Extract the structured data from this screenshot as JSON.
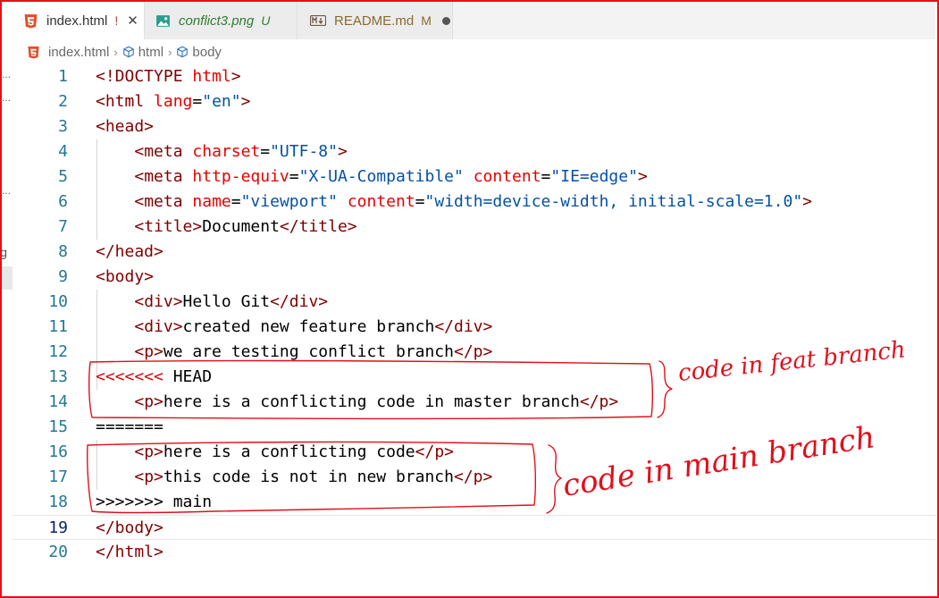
{
  "tabs": [
    {
      "name": "index.html",
      "status": "!",
      "icon": "html5-icon",
      "close": "✕",
      "active": true
    },
    {
      "name": "conflict3.png",
      "status": "U",
      "icon": "image-icon",
      "active": false
    },
    {
      "name": "README.md",
      "status": "M",
      "icon": "markdown-icon",
      "active": false,
      "dirty": true
    }
  ],
  "breadcrumb": {
    "file": "index.html",
    "items": [
      "html",
      "body"
    ]
  },
  "left_strip": {
    "glyph": "g"
  },
  "editor": {
    "lines": [
      {
        "n": "1",
        "tokens": [
          [
            "t",
            "<!DOCTYPE "
          ],
          [
            "a",
            "html"
          ],
          [
            "t",
            ">"
          ]
        ]
      },
      {
        "n": "2",
        "tokens": [
          [
            "t",
            "<html "
          ],
          [
            "a",
            "lang"
          ],
          [
            "p",
            "="
          ],
          [
            "s",
            "\"en\""
          ],
          [
            "t",
            ">"
          ]
        ]
      },
      {
        "n": "3",
        "tokens": [
          [
            "t",
            "<head>"
          ]
        ]
      },
      {
        "n": "4",
        "tokens": [
          [
            "p",
            "    "
          ],
          [
            "t",
            "<meta "
          ],
          [
            "a",
            "charset"
          ],
          [
            "p",
            "="
          ],
          [
            "s",
            "\"UTF-8\""
          ],
          [
            "t",
            ">"
          ]
        ]
      },
      {
        "n": "5",
        "tokens": [
          [
            "p",
            "    "
          ],
          [
            "t",
            "<meta "
          ],
          [
            "a",
            "http-equiv"
          ],
          [
            "p",
            "="
          ],
          [
            "s",
            "\"X-UA-Compatible\""
          ],
          [
            "p",
            " "
          ],
          [
            "a",
            "content"
          ],
          [
            "p",
            "="
          ],
          [
            "s",
            "\"IE=edge\""
          ],
          [
            "t",
            ">"
          ]
        ]
      },
      {
        "n": "6",
        "tokens": [
          [
            "p",
            "    "
          ],
          [
            "t",
            "<meta "
          ],
          [
            "a",
            "name"
          ],
          [
            "p",
            "="
          ],
          [
            "s",
            "\"viewport\""
          ],
          [
            "p",
            " "
          ],
          [
            "a",
            "content"
          ],
          [
            "p",
            "="
          ],
          [
            "s",
            "\"width=device-width, initial-scale=1.0\""
          ],
          [
            "t",
            ">"
          ]
        ]
      },
      {
        "n": "7",
        "tokens": [
          [
            "p",
            "    "
          ],
          [
            "t",
            "<title>"
          ],
          [
            "p",
            "Document"
          ],
          [
            "t",
            "</title>"
          ]
        ]
      },
      {
        "n": "8",
        "tokens": [
          [
            "t",
            "</head>"
          ]
        ]
      },
      {
        "n": "9",
        "tokens": [
          [
            "t",
            "<body>"
          ]
        ]
      },
      {
        "n": "10",
        "tokens": [
          [
            "p",
            "    "
          ],
          [
            "t",
            "<div>"
          ],
          [
            "p",
            "Hello Git"
          ],
          [
            "t",
            "</div>"
          ]
        ]
      },
      {
        "n": "11",
        "tokens": [
          [
            "p",
            "    "
          ],
          [
            "t",
            "<div>"
          ],
          [
            "p",
            "created new feature branch"
          ],
          [
            "t",
            "</div>"
          ]
        ]
      },
      {
        "n": "12",
        "tokens": [
          [
            "p",
            "    "
          ],
          [
            "t",
            "<p>"
          ],
          [
            "p",
            "we are testing conflict branch"
          ],
          [
            "t",
            "</p>"
          ]
        ]
      },
      {
        "n": "13",
        "tokens": [
          [
            "a",
            "<<<<<<<"
          ],
          [
            "p",
            " HEAD"
          ]
        ]
      },
      {
        "n": "14",
        "tokens": [
          [
            "p",
            "    "
          ],
          [
            "t",
            "<p>"
          ],
          [
            "p",
            "here is a conflicting code in master branch"
          ],
          [
            "t",
            "</p>"
          ]
        ]
      },
      {
        "n": "15",
        "tokens": [
          [
            "p",
            "======="
          ]
        ]
      },
      {
        "n": "16",
        "tokens": [
          [
            "p",
            "    "
          ],
          [
            "t",
            "<p>"
          ],
          [
            "p",
            "here is a conflicting code"
          ],
          [
            "t",
            "</p>"
          ]
        ]
      },
      {
        "n": "17",
        "tokens": [
          [
            "p",
            "    "
          ],
          [
            "t",
            "<p>"
          ],
          [
            "p",
            "this code is not in new branch"
          ],
          [
            "t",
            "</p>"
          ]
        ]
      },
      {
        "n": "18",
        "tokens": [
          [
            "p",
            ">>>>>>> main"
          ]
        ]
      },
      {
        "n": "19",
        "tokens": [
          [
            "t",
            "</body>"
          ]
        ],
        "current": true
      },
      {
        "n": "20",
        "tokens": [
          [
            "t",
            "</html>"
          ]
        ]
      }
    ]
  },
  "annotations": {
    "feat_label": "code in feat branch",
    "main_label": "code in main branch",
    "ink_color": "#e0101c"
  },
  "colors": {
    "tag": "#800000",
    "attribute": "#e50000",
    "string": "#0451a5",
    "line_number": "#237893",
    "frame": "#e5101a"
  }
}
